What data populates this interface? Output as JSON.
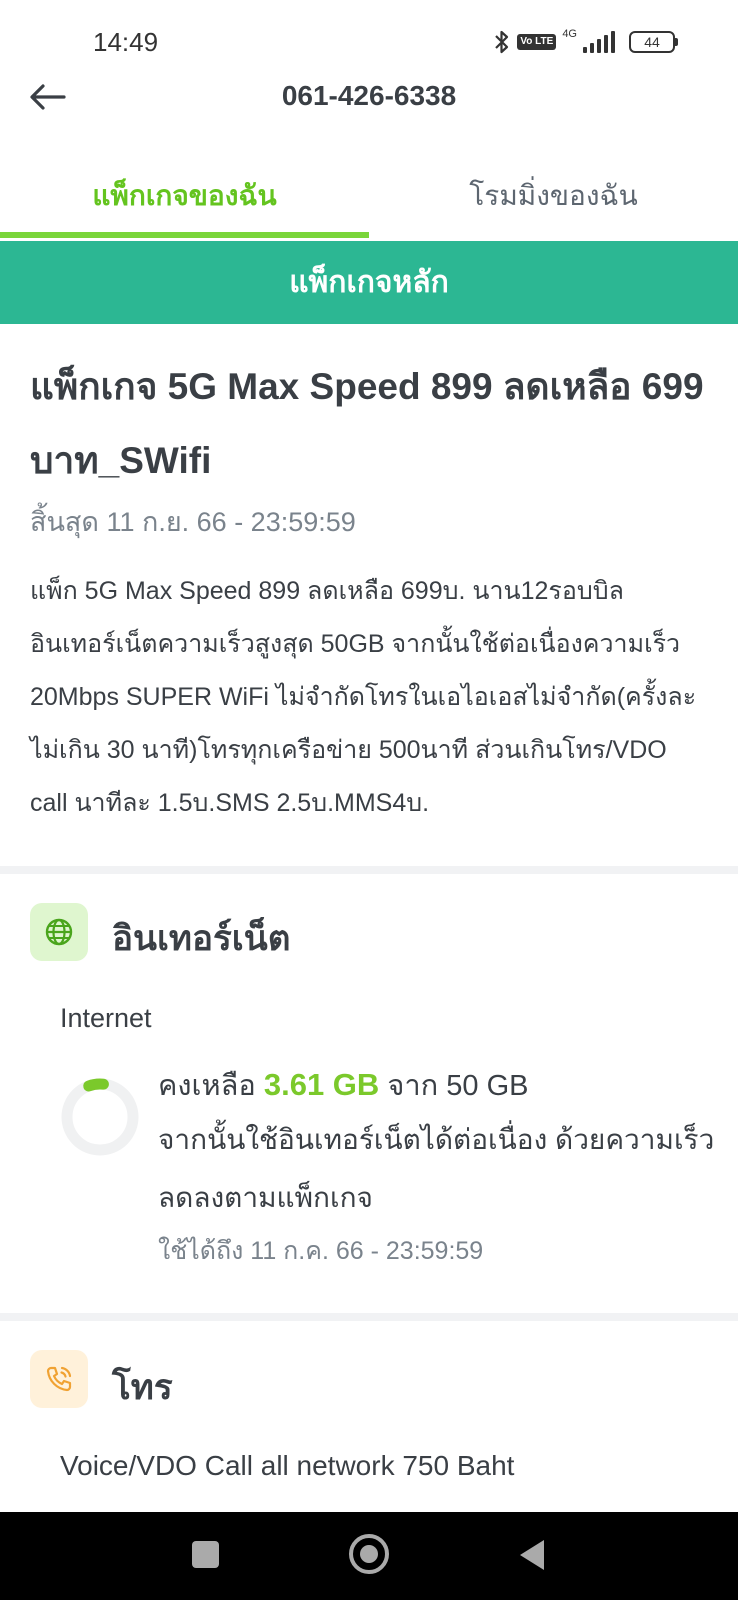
{
  "status_bar": {
    "time": "14:49",
    "network": "4G",
    "volte": "Vo LTE",
    "battery": "44"
  },
  "header": {
    "title": "061-426-6338",
    "back_icon": "arrow-left-icon"
  },
  "tabs": [
    {
      "label": "แพ็กเกจของฉัน",
      "active": true
    },
    {
      "label": "โรมมิ่งของฉัน",
      "active": false
    }
  ],
  "section_banner": "แพ็กเกจหลัก",
  "package": {
    "name": "แพ็กเกจ 5G Max Speed 899 ลดเหลือ 699 บาท_SWifi",
    "expiry": "สิ้นสุด 11 ก.ย. 66 - 23:59:59",
    "description": "แพ็ก 5G Max Speed 899 ลดเหลือ 699บ. นาน12รอบบิล อินเทอร์เน็ตความเร็วสูงสุด 50GB จากนั้นใช้ต่อเนื่องความเร็ว 20Mbps SUPER WiFi ไม่จำกัดโทรในเอไอเอสไม่จำกัด(ครั้งละไม่เกิน 30 นาที)โทรทุกเครือข่าย 500นาที ส่วนเกินโทร/VDO call นาทีละ 1.5บ.SMS 2.5บ.MMS4บ."
  },
  "internet": {
    "title": "อินเทอร์เน็ต",
    "icon": "globe-icon",
    "label": "Internet",
    "remaining_prefix": "คงเหลือ",
    "remaining": "3.61 GB",
    "total_text": "จาก 50 GB",
    "remaining_fraction": 0.072,
    "description": "จากนั้นใช้อินเทอร์เน็ตได้ต่อเนื่อง ด้วยความเร็วลดลงตามแพ็กเกจ",
    "valid_until": "ใช้ได้ถึง 11 ก.ค. 66 - 23:59:59",
    "accent_color": "#7bc92b"
  },
  "call": {
    "title": "โทร",
    "icon": "phone-call-icon",
    "label": "Voice/VDO Call all network 750 Baht"
  },
  "colors": {
    "brand_green": "#2cb793",
    "tab_active": "#64c41f",
    "tab_indicator": "#7ad53a"
  }
}
